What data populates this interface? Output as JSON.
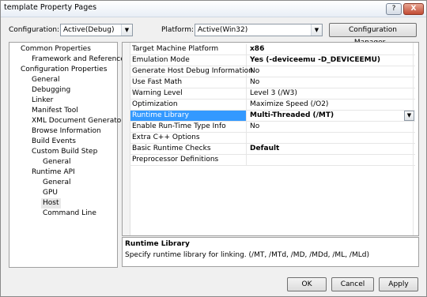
{
  "window": {
    "title": "template Property Pages",
    "help_label": "?",
    "close_label": "X"
  },
  "top": {
    "configuration_label": "Configuration:",
    "configuration_value": "Active(Debug)",
    "platform_label": "Platform:",
    "platform_value": "Active(Win32)",
    "config_manager_label": "Configuration Manager..."
  },
  "tree": {
    "items": [
      {
        "label": "Common Properties"
      },
      {
        "label": "Framework and References"
      },
      {
        "label": "Configuration Properties"
      },
      {
        "label": "General"
      },
      {
        "label": "Debugging"
      },
      {
        "label": "Linker"
      },
      {
        "label": "Manifest Tool"
      },
      {
        "label": "XML Document Generator"
      },
      {
        "label": "Browse Information"
      },
      {
        "label": "Build Events"
      },
      {
        "label": "Custom Build Step"
      },
      {
        "label": "General"
      },
      {
        "label": "Runtime API"
      },
      {
        "label": "General"
      },
      {
        "label": "GPU"
      },
      {
        "label": "Host"
      },
      {
        "label": "Command Line"
      }
    ]
  },
  "grid": {
    "rows": [
      {
        "name": "Target Machine Platform",
        "value": "x86"
      },
      {
        "name": "Emulation Mode",
        "value": "Yes (-deviceemu -D_DEVICEEMU)"
      },
      {
        "name": "Generate Host Debug Information",
        "value": "No"
      },
      {
        "name": "Use Fast Math",
        "value": "No"
      },
      {
        "name": "Warning Level",
        "value": "Level 3 (/W3)"
      },
      {
        "name": "Optimization",
        "value": "Maximize Speed (/O2)"
      },
      {
        "name": "Runtime Library",
        "value": "Multi-Threaded (/MT)"
      },
      {
        "name": "Enable Run-Time Type Info",
        "value": "No"
      },
      {
        "name": "Extra C++ Options",
        "value": ""
      },
      {
        "name": "Basic Runtime Checks",
        "value": "Default"
      },
      {
        "name": "Preprocessor Definitions",
        "value": ""
      }
    ]
  },
  "description": {
    "title": "Runtime Library",
    "text": "Specify runtime library for linking.   (/MT, /MTd, /MD, /MDd, /ML, /MLd)"
  },
  "buttons": {
    "ok": "OK",
    "cancel": "Cancel",
    "apply": "Apply"
  }
}
